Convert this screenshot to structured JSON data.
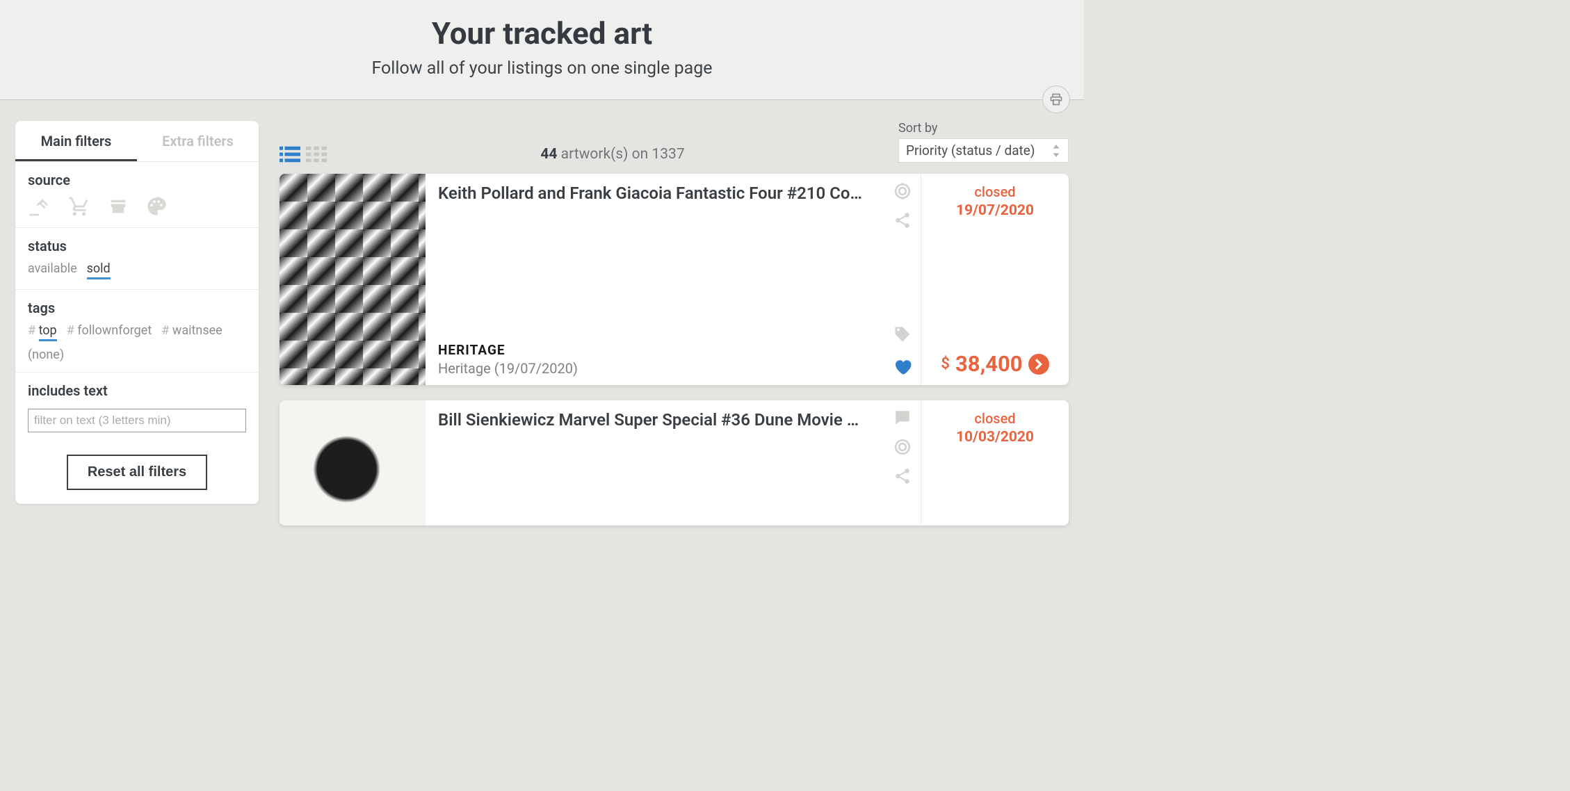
{
  "header": {
    "title": "Your tracked art",
    "subtitle": "Follow all of your listings on one single page"
  },
  "sidebar": {
    "tabs": {
      "main": "Main filters",
      "extra": "Extra filters"
    },
    "source_label": "source",
    "status": {
      "label": "status",
      "options": {
        "available": "available",
        "sold": "sold"
      }
    },
    "tags": {
      "label": "tags",
      "top": "top",
      "follownforget": "follownforget",
      "waitnsee": "waitnsee",
      "none": "(none)"
    },
    "includes": {
      "label": "includes text",
      "placeholder": "filter on text (3 letters min)"
    },
    "reset": "Reset all filters"
  },
  "toolbar": {
    "count_num": "44",
    "count_rest": " artwork(s) on 1337",
    "sort_label": "Sort by",
    "sort_value": "Priority (status / date)"
  },
  "listings": [
    {
      "title": "Keith Pollard and Frank Giacoia Fantastic Four #210 Co…",
      "source_logo": "HERITAGE",
      "source_meta": "Heritage (19/07/2020)",
      "status": "closed",
      "date": "19/07/2020",
      "currency": "$",
      "price": "38,400"
    },
    {
      "title": "Bill Sienkiewicz Marvel Super Special #36 Dune Movie …",
      "status": "closed",
      "date": "10/03/2020"
    }
  ]
}
